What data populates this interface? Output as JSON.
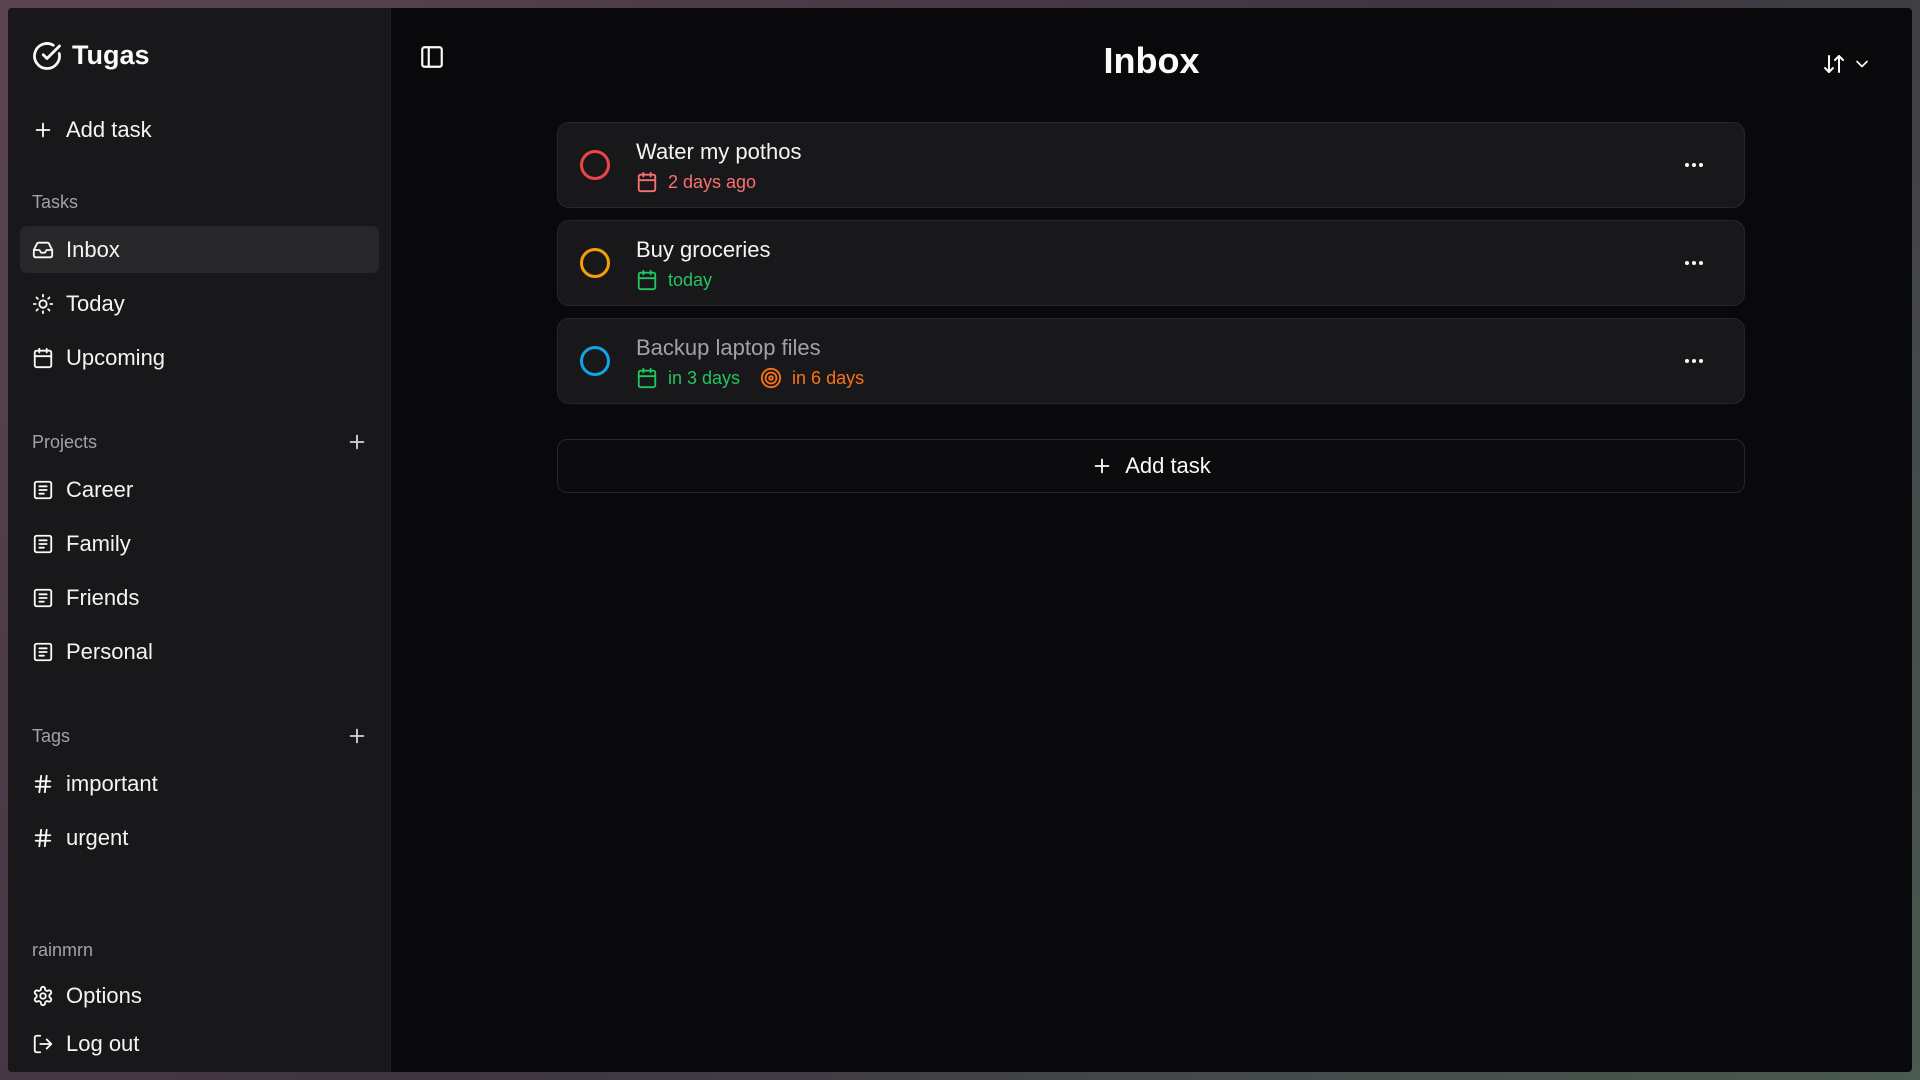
{
  "app": {
    "name": "Tugas"
  },
  "sidebar": {
    "add_task_label": "Add task",
    "tasks_section_label": "Tasks",
    "task_views": [
      {
        "label": "Inbox",
        "icon": "inbox-icon",
        "active": true
      },
      {
        "label": "Today",
        "icon": "sun-icon",
        "active": false
      },
      {
        "label": "Upcoming",
        "icon": "calendar-icon",
        "active": false
      }
    ],
    "projects_section_label": "Projects",
    "projects": [
      {
        "label": "Career",
        "icon": "project-icon"
      },
      {
        "label": "Family",
        "icon": "project-icon"
      },
      {
        "label": "Friends",
        "icon": "project-icon"
      },
      {
        "label": "Personal",
        "icon": "project-icon"
      }
    ],
    "tags_section_label": "Tags",
    "tags": [
      {
        "label": "important",
        "icon": "hash-icon"
      },
      {
        "label": "urgent",
        "icon": "hash-icon"
      }
    ],
    "username": "rainmrn",
    "options_label": "Options",
    "logout_label": "Log out"
  },
  "main": {
    "title": "Inbox",
    "tasks": [
      {
        "title": "Water my pothos",
        "check_color": "#ef4444",
        "due": {
          "label": "2 days ago",
          "color": "#f87171",
          "icon": "calendar-icon"
        }
      },
      {
        "title": "Buy groceries",
        "check_color": "#f59e0b",
        "due": {
          "label": "today",
          "color": "#22c55e",
          "icon": "calendar-icon"
        }
      },
      {
        "title": "Backup laptop files",
        "check_color": "#0ea5e9",
        "due": {
          "label": "in 3 days",
          "color": "#22c55e",
          "icon": "calendar-icon"
        },
        "deadline": {
          "label": "in 6 days",
          "color": "#f97316",
          "icon": "target-icon"
        }
      }
    ],
    "add_task_label": "Add task"
  },
  "colors": {
    "background": "#09090b",
    "sidebar": "#18181b",
    "card": "#18181b",
    "active_item": "#27272a",
    "muted_text": "#a1a1aa"
  }
}
